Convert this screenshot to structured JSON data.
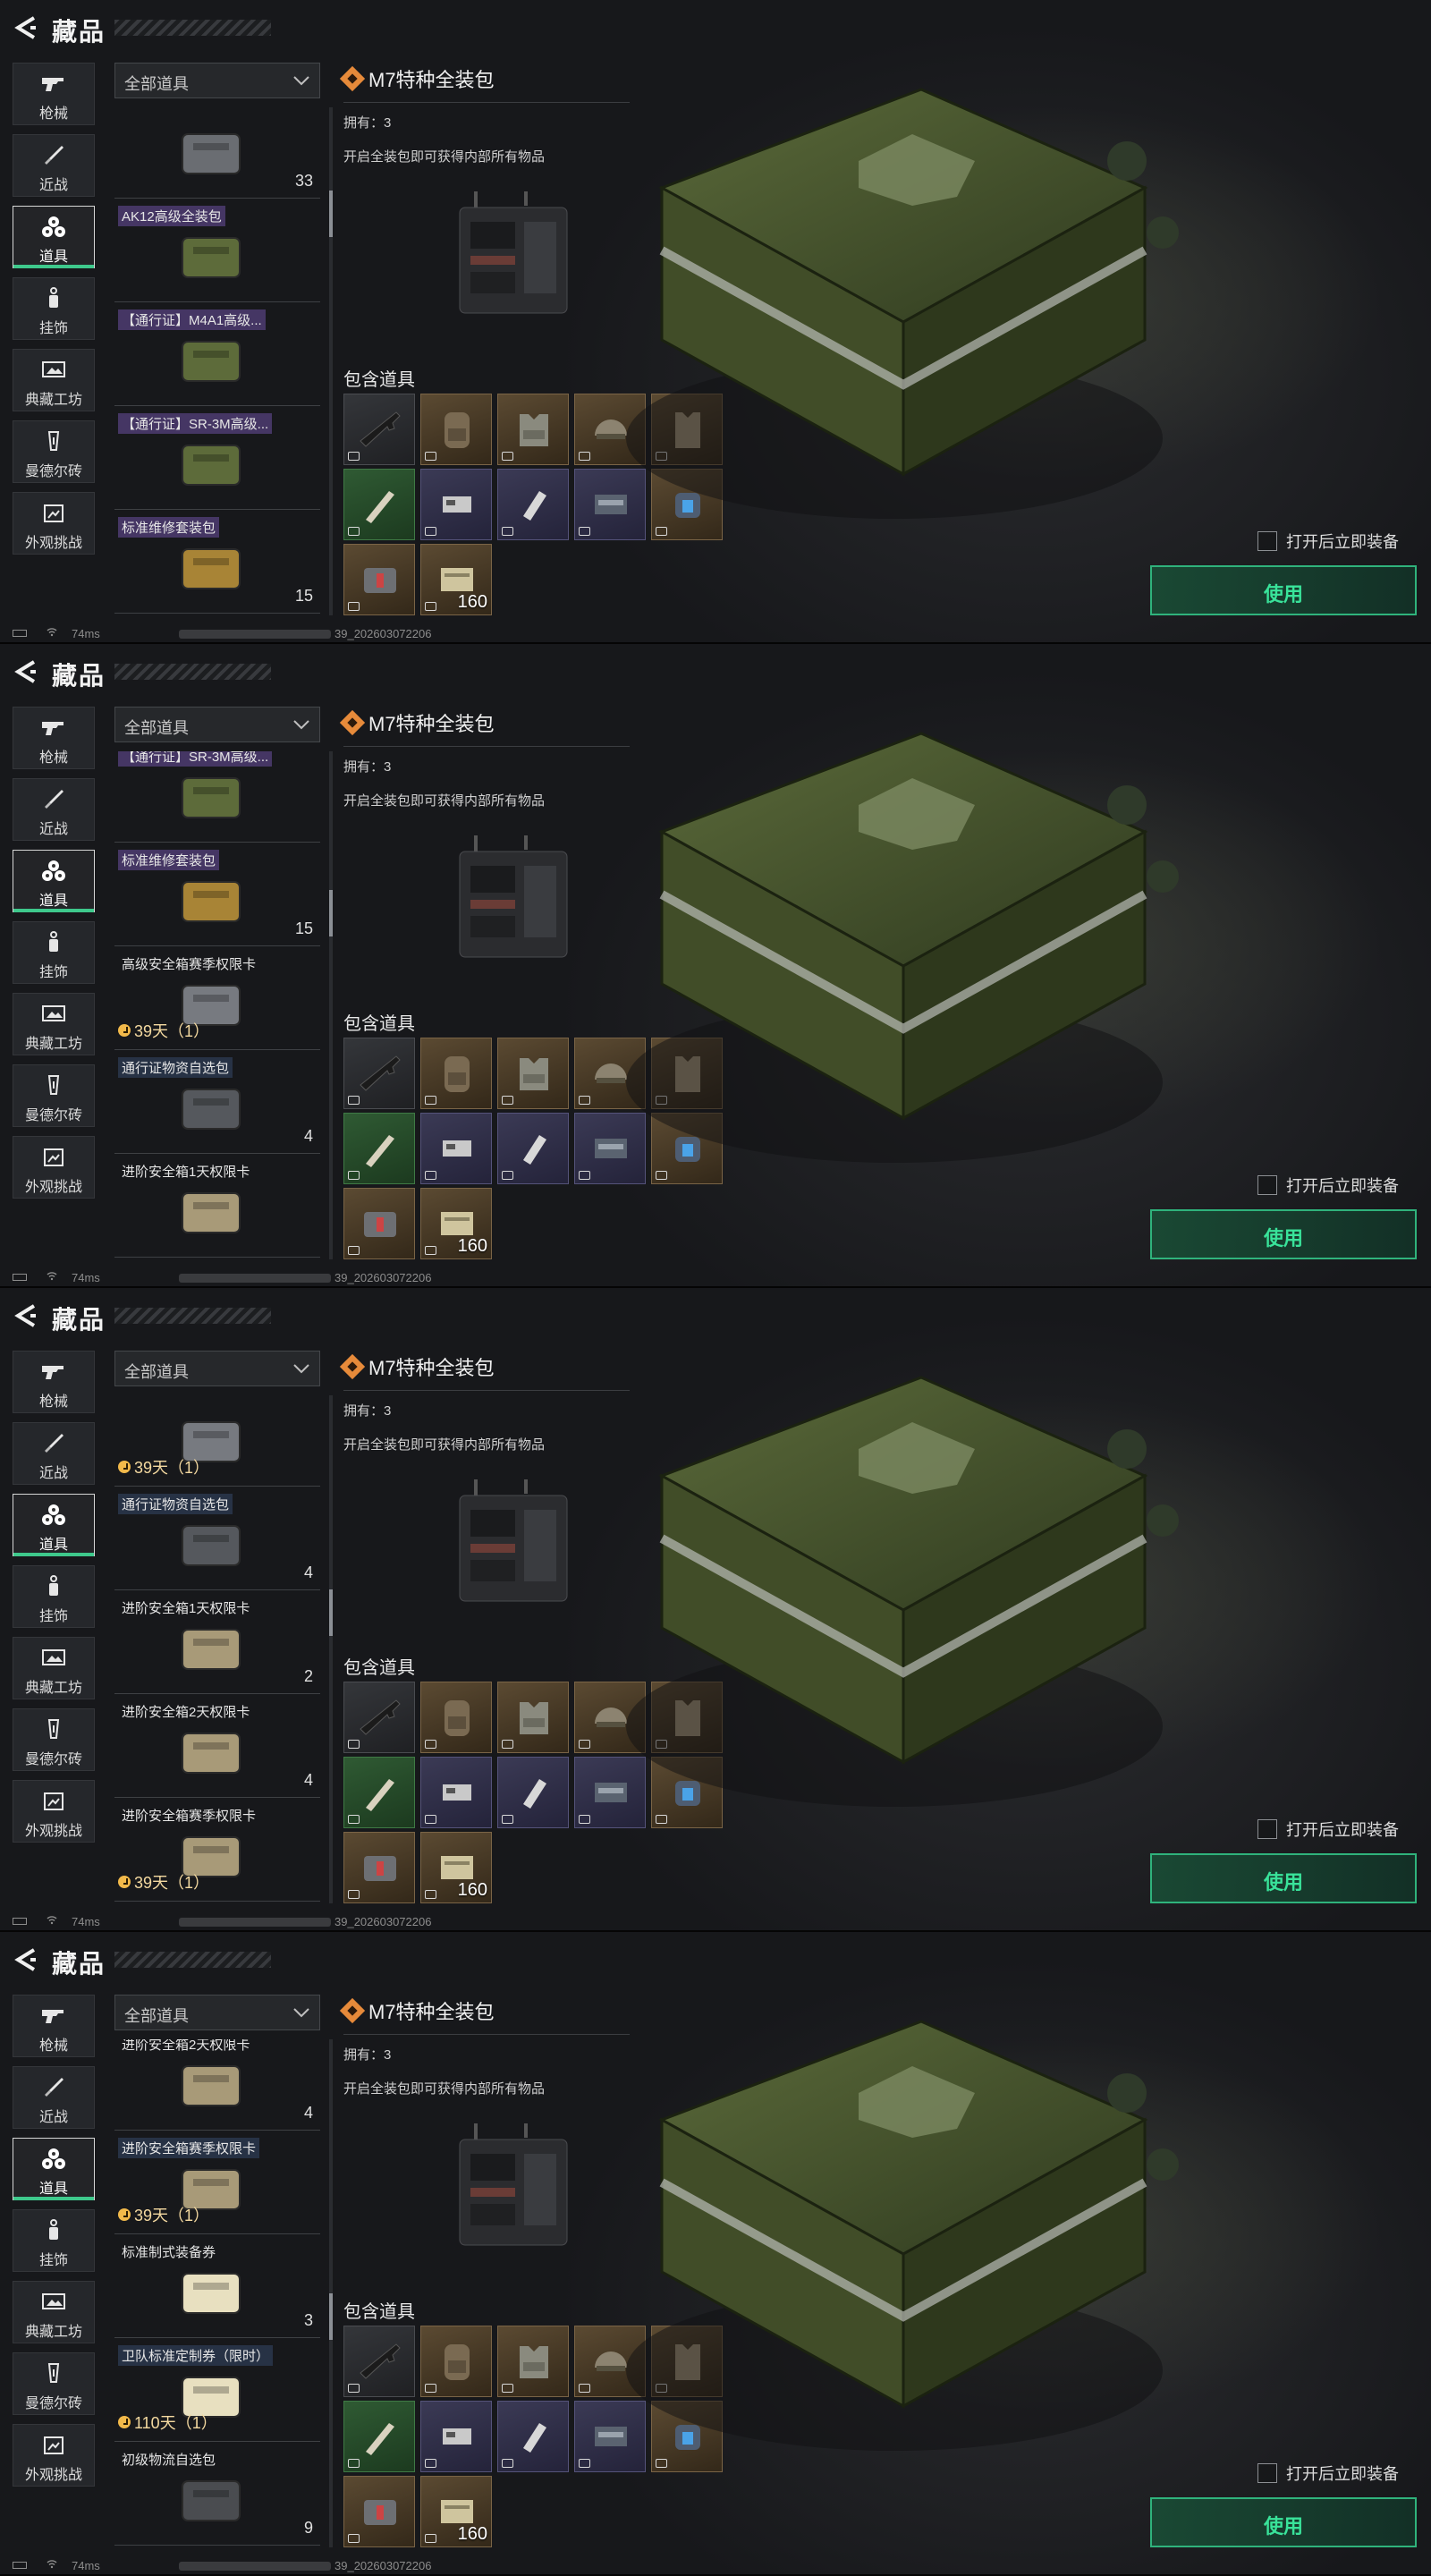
{
  "header": {
    "title": "藏品"
  },
  "categories": [
    {
      "label": "枪械",
      "icon": "gun-icon"
    },
    {
      "label": "近战",
      "icon": "knife-icon"
    },
    {
      "label": "道具",
      "icon": "items-icon"
    },
    {
      "label": "挂饰",
      "icon": "charm-icon"
    },
    {
      "label": "典藏工坊",
      "icon": "workshop-icon"
    },
    {
      "label": "曼德尔砖",
      "icon": "brick-icon"
    },
    {
      "label": "外观挑战",
      "icon": "challenge-icon"
    }
  ],
  "active_category": "道具",
  "filter": {
    "label": "全部道具"
  },
  "detail": {
    "title": "M7特种全装包",
    "owned": "拥有：3",
    "description": "开启全装包即可获得内部所有物品",
    "contains_label": "包含道具",
    "contents": [
      {
        "name": "rifle",
        "rarity": "gray",
        "qty": ""
      },
      {
        "name": "backpack",
        "rarity": "gold",
        "qty": ""
      },
      {
        "name": "chest-rig",
        "rarity": "gold",
        "qty": ""
      },
      {
        "name": "helmet",
        "rarity": "gold",
        "qty": ""
      },
      {
        "name": "armor-vest",
        "rarity": "gold",
        "qty": ""
      },
      {
        "name": "syringe",
        "rarity": "green",
        "qty": ""
      },
      {
        "name": "ammo-box",
        "rarity": "purple",
        "qty": ""
      },
      {
        "name": "bandage",
        "rarity": "purple",
        "qty": ""
      },
      {
        "name": "med-case",
        "rarity": "purple",
        "qty": ""
      },
      {
        "name": "canteen",
        "rarity": "gold",
        "qty": ""
      },
      {
        "name": "medkit",
        "rarity": "gold",
        "qty": ""
      },
      {
        "name": "ammo",
        "rarity": "gold",
        "qty": "160"
      }
    ]
  },
  "actions": {
    "auto_equip_label": "打开后立即装备",
    "use_label": "使用"
  },
  "status": {
    "ping": "74ms",
    "version": "39_20260307220б"
  },
  "panels": [
    {
      "items": [
        {
          "name": "",
          "count": "33",
          "timer": "",
          "color": "#6a6d72",
          "style": "plain"
        },
        {
          "name": "AK12高级全装包",
          "count": "",
          "timer": "",
          "color": "#5d6b3a",
          "style": "pass"
        },
        {
          "name": "【通行证】M4A1高级...",
          "count": "",
          "timer": "",
          "color": "#5d6b3a",
          "style": "pass"
        },
        {
          "name": "【通行证】SR-3M高级...",
          "count": "",
          "timer": "",
          "color": "#5d6b3a",
          "style": "pass"
        },
        {
          "name": "标准维修套装包",
          "count": "15",
          "timer": "",
          "color": "#a88436",
          "style": "pass"
        },
        {
          "name": "高级安全箱赛季权限卡",
          "count": "",
          "timer": "",
          "color": "#777a80",
          "style": "plain"
        }
      ],
      "scroll": 0.18
    },
    {
      "items": [
        {
          "name": "【通行证】SR-3M高级...",
          "count": "",
          "timer": "",
          "color": "#5d6b3a",
          "style": "pass"
        },
        {
          "name": "标准维修套装包",
          "count": "15",
          "timer": "",
          "color": "#a88436",
          "style": "pass"
        },
        {
          "name": "高级安全箱赛季权限卡",
          "count": "",
          "timer": "39天（1）",
          "color": "#777a80",
          "style": "plain"
        },
        {
          "name": "通行证物资自选包",
          "count": "4",
          "timer": "",
          "color": "#55585d",
          "style": "safe"
        },
        {
          "name": "进阶安全箱1天权限卡",
          "count": "",
          "timer": "",
          "color": "#a89a78",
          "style": "plain"
        }
      ],
      "scroll": 0.3
    },
    {
      "items": [
        {
          "name": "",
          "count": "",
          "timer": "39天（1）",
          "color": "#777a80",
          "style": "plain"
        },
        {
          "name": "通行证物资自选包",
          "count": "4",
          "timer": "",
          "color": "#55585d",
          "style": "safe"
        },
        {
          "name": "进阶安全箱1天权限卡",
          "count": "2",
          "timer": "",
          "color": "#a89a78",
          "style": "plain"
        },
        {
          "name": "进阶安全箱2天权限卡",
          "count": "4",
          "timer": "",
          "color": "#a89a78",
          "style": "plain"
        },
        {
          "name": "进阶安全箱赛季权限卡",
          "count": "",
          "timer": "39天（1）",
          "color": "#a89a78",
          "style": "plain"
        },
        {
          "name": "标准制式装备券",
          "count": "",
          "timer": "",
          "color": "#e8e0c0",
          "style": "plain"
        }
      ],
      "scroll": 0.42
    },
    {
      "items": [
        {
          "name": "进阶安全箱2天权限卡",
          "count": "4",
          "timer": "",
          "color": "#a89a78",
          "style": "plain"
        },
        {
          "name": "进阶安全箱赛季权限卡",
          "count": "",
          "timer": "39天（1）",
          "color": "#a89a78",
          "style": "safe"
        },
        {
          "name": "标准制式装备券",
          "count": "3",
          "timer": "",
          "color": "#e8e0c0",
          "style": "plain"
        },
        {
          "name": "卫队标准定制券（限时）",
          "count": "",
          "timer": "110天（1）",
          "color": "#e8e0c0",
          "style": "safe"
        },
        {
          "name": "初级物流自选包",
          "count": "9",
          "timer": "",
          "color": "#4a4c50",
          "style": "plain"
        }
      ],
      "scroll": 0.55
    }
  ]
}
